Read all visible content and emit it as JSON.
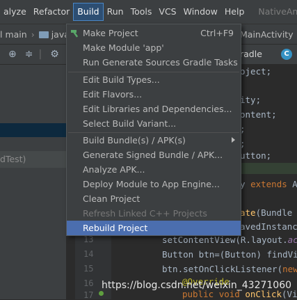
{
  "menubar": {
    "items": [
      "alyze",
      "Refactor",
      "Build",
      "Run",
      "Tools",
      "VCS",
      "Window",
      "Help"
    ],
    "project": "NativeAn"
  },
  "navbar": {
    "module": "l main",
    "folder": "java",
    "file": "MainActivity"
  },
  "tabs": {
    "gradle": "radle",
    "class_icon": "C"
  },
  "left_panel": {
    "test_item": "dTest)"
  },
  "build_menu": {
    "items": [
      {
        "label": "Make Project",
        "shortcut": "Ctrl+F9"
      },
      {
        "label": "Make Module 'app'"
      },
      {
        "label": "Run Generate Sources Gradle Tasks"
      },
      {
        "label": "Edit Build Types..."
      },
      {
        "label": "Edit Flavors..."
      },
      {
        "label": "Edit Libraries and Dependencies..."
      },
      {
        "label": "Select Build Variant..."
      },
      {
        "label": "Build Bundle(s) / APK(s)"
      },
      {
        "label": "Generate Signed Bundle / APK..."
      },
      {
        "label": "Analyze APK..."
      },
      {
        "label": "Deploy Module to App Engine..."
      },
      {
        "label": "Clean Project"
      },
      {
        "label": "Refresh Linked C++ Projects"
      },
      {
        "label": "Rebuild Project"
      }
    ]
  },
  "code": {
    "right_fragments": [
      "oject;",
      "ity;",
      "ontent;",
      ";",
      ";",
      "utton;"
    ],
    "line10": [
      "y ",
      "extends",
      " Ac"
    ],
    "line11": [
      "ate",
      "(Bundle s"
    ],
    "line12": "avedInstance",
    "line13": [
      "setContentView(R.layout.",
      "acti"
    ],
    "line15": "Button btn=(Button) findView",
    "line16": [
      "btn.setOnClickListener(",
      "new",
      " V"
    ],
    "line_override": "@Override",
    "line17": [
      "public",
      "void",
      "onClick",
      "(View"
    ],
    "line_numbers": [
      "13",
      "14",
      "15",
      "16",
      "17"
    ]
  },
  "watermark": "https://blog.csdn.net/weixin_43271060",
  "colors": {
    "menu_highlight": "#4b6eaf",
    "active_menu": "#2d4e72"
  }
}
